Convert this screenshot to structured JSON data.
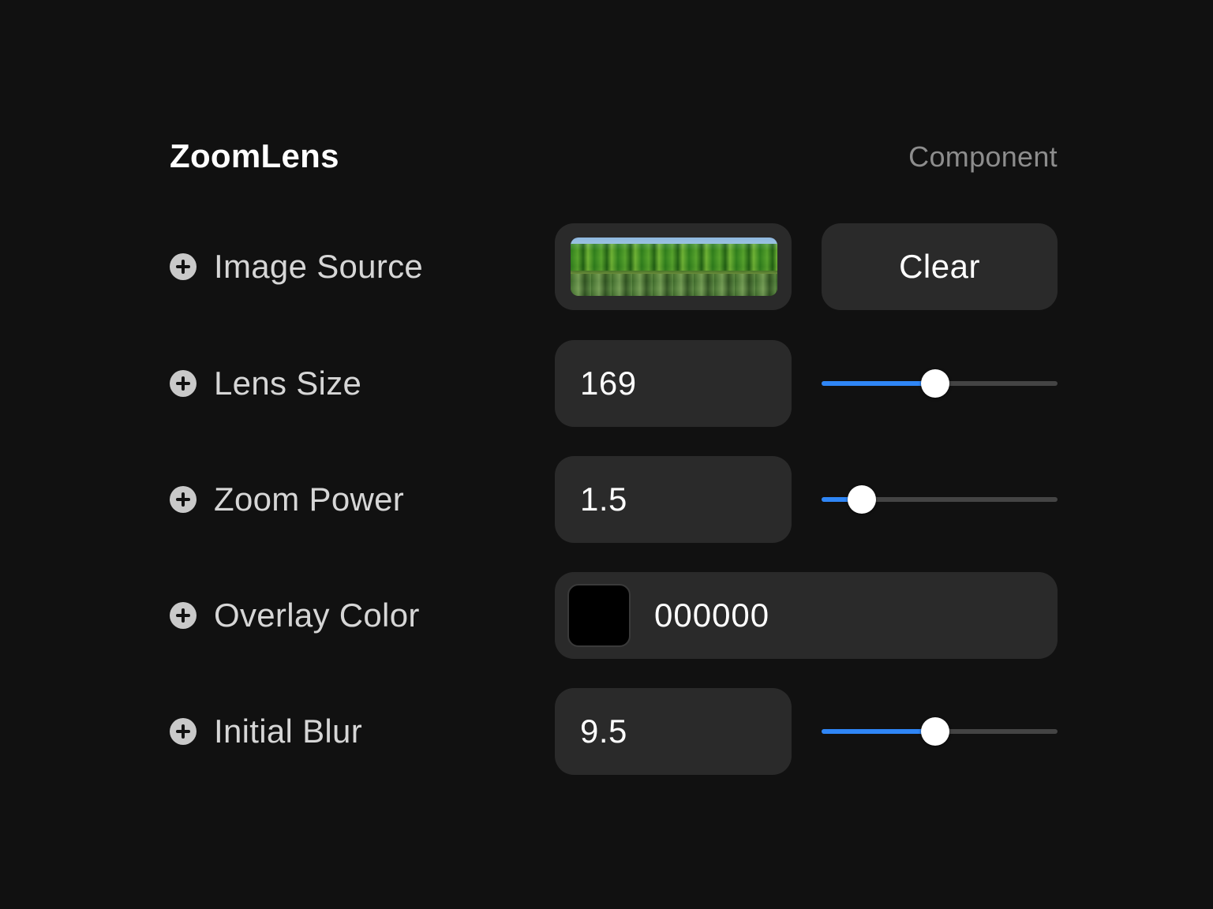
{
  "panel": {
    "title": "ZoomLens",
    "subtitle": "Component"
  },
  "rows": {
    "image_source": {
      "label": "Image Source",
      "clear_label": "Clear"
    },
    "lens_size": {
      "label": "Lens Size",
      "value": "169",
      "slider_fraction": 0.48
    },
    "zoom_power": {
      "label": "Zoom Power",
      "value": "1.5",
      "slider_fraction": 0.17
    },
    "overlay_color": {
      "label": "Overlay Color",
      "hex": "000000",
      "swatch_color": "#000000"
    },
    "initial_blur": {
      "label": "Initial Blur",
      "value": "9.5",
      "slider_fraction": 0.48
    }
  },
  "colors": {
    "background": "#111111",
    "field": "#2a2a2a",
    "accent": "#2f86f6"
  },
  "icons": {
    "row_icon": "plus-circle-icon"
  }
}
